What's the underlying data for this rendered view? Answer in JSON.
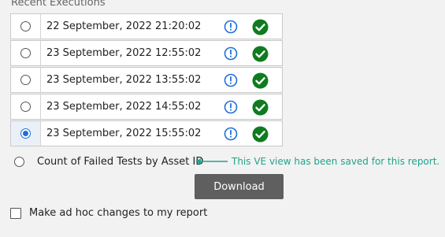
{
  "section": {
    "title": "Recent Executions"
  },
  "executions": [
    {
      "timestamp": "22 September, 2022 21:20:02",
      "selected": false
    },
    {
      "timestamp": "23 September, 2022 12:55:02",
      "selected": false
    },
    {
      "timestamp": "23 September, 2022 13:55:02",
      "selected": false
    },
    {
      "timestamp": "23 September, 2022 14:55:02",
      "selected": false
    },
    {
      "timestamp": "23 September, 2022 15:55:02",
      "selected": true
    }
  ],
  "icons": {
    "info": "info-circle-icon",
    "status": "check-circle-icon"
  },
  "colors": {
    "info": "#1e6fd9",
    "success": "#0f7b1f",
    "note": "#21a38c",
    "button": "#5f5f5f"
  },
  "view_option": {
    "label": "Count of Failed Tests by Asset ID",
    "note": "This VE view has been saved for this report."
  },
  "download": {
    "label": "Download"
  },
  "adhoc": {
    "label": "Make ad hoc changes to my report",
    "checked": false
  }
}
